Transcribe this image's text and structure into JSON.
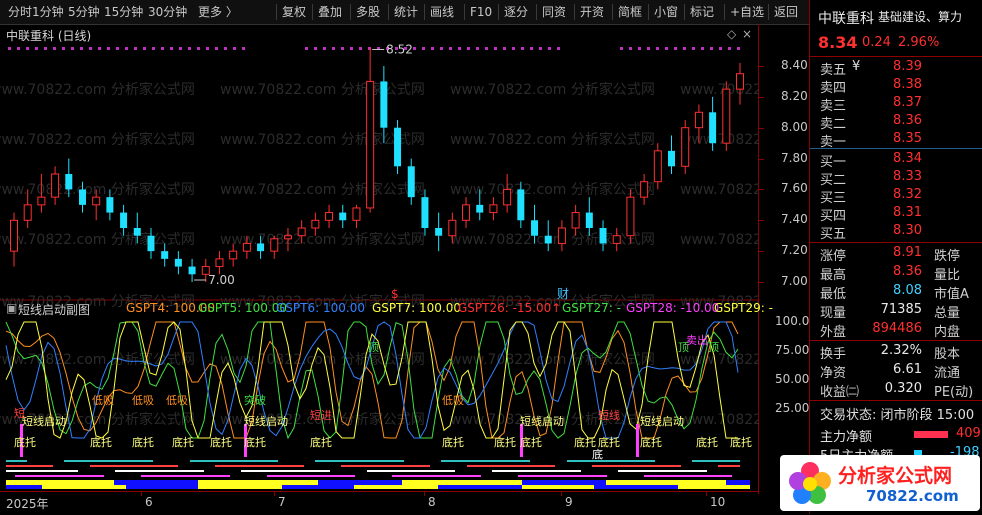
{
  "toolbar": {
    "items": [
      "分时",
      "1分钟",
      "5分钟",
      "15分钟",
      "30分钟",
      "更多 〉",
      "复权",
      "叠加",
      "多股",
      "统计",
      "画线",
      "F10",
      "逐分",
      "同资",
      "开资",
      "简框",
      "小窗",
      "标记",
      "+自选",
      "返回"
    ]
  },
  "chart": {
    "title": "中联重科 (日线)",
    "high_label": "8.52",
    "low_label": "7.00",
    "markers": {
      "s": "$",
      "cai": "财"
    },
    "y_ticks": [
      "8.40",
      "8.20",
      "8.00",
      "7.80",
      "7.60",
      "7.40",
      "7.20",
      "7.00"
    ],
    "sub_ticks": [
      "100.0",
      "75.00",
      "50.00",
      "25.00"
    ],
    "x_labels": [
      "2025年",
      "6",
      "7",
      "8",
      "9",
      "10"
    ],
    "watermark": "www.70822.com 分析家公式网",
    "candles": [
      [
        7.2,
        7.45,
        7.1,
        7.4
      ],
      [
        7.4,
        7.6,
        7.35,
        7.5
      ],
      [
        7.5,
        7.7,
        7.45,
        7.55
      ],
      [
        7.55,
        7.75,
        7.5,
        7.7
      ],
      [
        7.7,
        7.8,
        7.55,
        7.6
      ],
      [
        7.6,
        7.65,
        7.45,
        7.5
      ],
      [
        7.5,
        7.6,
        7.4,
        7.55
      ],
      [
        7.55,
        7.6,
        7.4,
        7.45
      ],
      [
        7.45,
        7.5,
        7.3,
        7.35
      ],
      [
        7.35,
        7.45,
        7.25,
        7.3
      ],
      [
        7.3,
        7.35,
        7.15,
        7.2
      ],
      [
        7.2,
        7.25,
        7.1,
        7.15
      ],
      [
        7.15,
        7.2,
        7.05,
        7.1
      ],
      [
        7.1,
        7.15,
        7.0,
        7.05
      ],
      [
        7.05,
        7.15,
        7.0,
        7.1
      ],
      [
        7.1,
        7.2,
        7.05,
        7.15
      ],
      [
        7.15,
        7.25,
        7.1,
        7.2
      ],
      [
        7.2,
        7.3,
        7.15,
        7.25
      ],
      [
        7.25,
        7.3,
        7.15,
        7.2
      ],
      [
        7.2,
        7.3,
        7.15,
        7.28
      ],
      [
        7.28,
        7.35,
        7.2,
        7.3
      ],
      [
        7.3,
        7.4,
        7.25,
        7.35
      ],
      [
        7.35,
        7.45,
        7.3,
        7.4
      ],
      [
        7.4,
        7.5,
        7.35,
        7.45
      ],
      [
        7.45,
        7.5,
        7.35,
        7.4
      ],
      [
        7.4,
        7.5,
        7.35,
        7.48
      ],
      [
        7.48,
        8.52,
        7.45,
        8.3
      ],
      [
        8.3,
        8.4,
        7.9,
        8.0
      ],
      [
        8.0,
        8.05,
        7.7,
        7.75
      ],
      [
        7.75,
        7.8,
        7.5,
        7.55
      ],
      [
        7.55,
        7.6,
        7.3,
        7.35
      ],
      [
        7.35,
        7.45,
        7.2,
        7.3
      ],
      [
        7.3,
        7.45,
        7.25,
        7.4
      ],
      [
        7.4,
        7.55,
        7.35,
        7.5
      ],
      [
        7.5,
        7.6,
        7.4,
        7.45
      ],
      [
        7.45,
        7.55,
        7.4,
        7.5
      ],
      [
        7.5,
        7.7,
        7.45,
        7.6
      ],
      [
        7.6,
        7.65,
        7.35,
        7.4
      ],
      [
        7.4,
        7.5,
        7.25,
        7.3
      ],
      [
        7.3,
        7.4,
        7.2,
        7.25
      ],
      [
        7.25,
        7.4,
        7.2,
        7.35
      ],
      [
        7.35,
        7.5,
        7.3,
        7.45
      ],
      [
        7.45,
        7.55,
        7.3,
        7.35
      ],
      [
        7.35,
        7.4,
        7.2,
        7.25
      ],
      [
        7.25,
        7.35,
        7.2,
        7.3
      ],
      [
        7.3,
        7.6,
        7.25,
        7.55
      ],
      [
        7.55,
        7.7,
        7.5,
        7.65
      ],
      [
        7.65,
        7.9,
        7.6,
        7.85
      ],
      [
        7.85,
        7.95,
        7.7,
        7.75
      ],
      [
        7.75,
        8.05,
        7.7,
        8.0
      ],
      [
        8.0,
        8.15,
        7.9,
        8.1
      ],
      [
        8.1,
        8.2,
        7.85,
        7.9
      ],
      [
        7.9,
        8.3,
        7.85,
        8.25
      ],
      [
        8.25,
        8.42,
        8.15,
        8.35
      ]
    ]
  },
  "quote": {
    "name": "中联重科",
    "industry": "基础建设、算力",
    "price": "8.34",
    "change": "0.24",
    "pct": "2.96%",
    "asks": [
      [
        "卖五",
        "8.39"
      ],
      [
        "卖四",
        "8.38"
      ],
      [
        "卖三",
        "8.37"
      ],
      [
        "卖二",
        "8.36"
      ],
      [
        "卖一",
        "8.35"
      ]
    ],
    "bids": [
      [
        "买一",
        "8.34"
      ],
      [
        "买二",
        "8.33"
      ],
      [
        "买三",
        "8.32"
      ],
      [
        "买四",
        "8.31"
      ],
      [
        "买五",
        "8.30"
      ]
    ],
    "ask_label_extra": "¥",
    "stats": [
      {
        "l": "涨停",
        "v": "8.91",
        "c": "red",
        "l2": "跌停"
      },
      {
        "l": "最高",
        "v": "8.36",
        "c": "red",
        "l2": "量比"
      },
      {
        "l": "最低",
        "v": "8.08",
        "c": "cyan",
        "l2": "市值A"
      },
      {
        "l": "现量",
        "v": "71385",
        "c": "white",
        "l2": "总量"
      },
      {
        "l": "外盘",
        "v": "894486",
        "c": "red",
        "l2": "内盘"
      }
    ],
    "stats2": [
      {
        "l": "换手",
        "v": "2.32%",
        "l2": "股本"
      },
      {
        "l": "净资",
        "v": "6.61",
        "l2": "流通"
      },
      {
        "l": "收益㈡",
        "v": "0.320",
        "l2": "PE(动)"
      }
    ],
    "trade_state": "交易状态: 闭市阶段 15:00",
    "main_flow_label": "主力净额",
    "main_flow_val": "409",
    "flow5_label": "5日主力净额",
    "flow5_val": "-198",
    "logo_text": "分析家公式网",
    "logo_url": "70822.com"
  },
  "indicator": {
    "legend": [
      {
        "t": "短线启动副图",
        "c": "#d0d0d0"
      },
      {
        "t": "GSPT4: 100.00",
        "c": "#ff9020"
      },
      {
        "t": "GSPT5: 100.00",
        "c": "#40e040"
      },
      {
        "t": "GSPT6: 100.00",
        "c": "#3080ff"
      },
      {
        "t": "GSPT7: 100.00",
        "c": "#ffff40"
      },
      {
        "t": "GSPT26: -15.00↑",
        "c": "#ff3030"
      },
      {
        "t": "GSPT27: -",
        "c": "#40e040"
      },
      {
        "t": "GSPT28: -10.00",
        "c": "#ff40ff"
      },
      {
        "t": "GSPT29: -",
        "c": "#ffff40"
      }
    ],
    "labels": [
      {
        "t": "底托",
        "c": "#ffff80",
        "x": 14,
        "y": 422
      },
      {
        "t": "短线启动",
        "c": "#ffff80",
        "x": 22,
        "y": 401
      },
      {
        "t": "短",
        "c": "#ff4040",
        "x": 14,
        "y": 393
      },
      {
        "t": "低吸",
        "c": "#ff9020",
        "x": 92,
        "y": 380
      },
      {
        "t": "低吸",
        "c": "#ff9020",
        "x": 132,
        "y": 380
      },
      {
        "t": "低吸",
        "c": "#ff9020",
        "x": 166,
        "y": 380
      },
      {
        "t": "底托",
        "c": "#ffff80",
        "x": 90,
        "y": 422
      },
      {
        "t": "底托",
        "c": "#ffff80",
        "x": 132,
        "y": 422
      },
      {
        "t": "底托",
        "c": "#ffff80",
        "x": 172,
        "y": 422
      },
      {
        "t": "底托",
        "c": "#ffff80",
        "x": 210,
        "y": 422
      },
      {
        "t": "突破",
        "c": "#40e040",
        "x": 244,
        "y": 380
      },
      {
        "t": "短线启动",
        "c": "#ffff80",
        "x": 244,
        "y": 401
      },
      {
        "t": "底托",
        "c": "#ffff80",
        "x": 244,
        "y": 422
      },
      {
        "t": "短进",
        "c": "#ff4040",
        "x": 310,
        "y": 395
      },
      {
        "t": "底托",
        "c": "#ffff80",
        "x": 310,
        "y": 422
      },
      {
        "t": "顶",
        "c": "#40e040",
        "x": 368,
        "y": 327
      },
      {
        "t": "低吸",
        "c": "#ff9020",
        "x": 442,
        "y": 380
      },
      {
        "t": "底托",
        "c": "#ffff80",
        "x": 442,
        "y": 422
      },
      {
        "t": "底托",
        "c": "#ffff80",
        "x": 494,
        "y": 422
      },
      {
        "t": "短线启动",
        "c": "#ffff80",
        "x": 520,
        "y": 401
      },
      {
        "t": "底托",
        "c": "#ffff80",
        "x": 520,
        "y": 422
      },
      {
        "t": "底托",
        "c": "#ffff80",
        "x": 574,
        "y": 422
      },
      {
        "t": "底",
        "c": "#ffffff",
        "x": 592,
        "y": 434
      },
      {
        "t": "短线",
        "c": "#ff4040",
        "x": 598,
        "y": 395
      },
      {
        "t": "底托",
        "c": "#ffff80",
        "x": 598,
        "y": 422
      },
      {
        "t": "短线启动",
        "c": "#ffff80",
        "x": 640,
        "y": 401
      },
      {
        "t": "底托",
        "c": "#ffff80",
        "x": 640,
        "y": 422
      },
      {
        "t": "底托",
        "c": "#ffff80",
        "x": 696,
        "y": 422
      },
      {
        "t": "底托",
        "c": "#ffff80",
        "x": 730,
        "y": 422
      },
      {
        "t": "顶",
        "c": "#40e040",
        "x": 678,
        "y": 327
      },
      {
        "t": "顶",
        "c": "#40e040",
        "x": 708,
        "y": 327
      },
      {
        "t": "卖出",
        "c": "#ff40ff",
        "x": 686,
        "y": 320
      }
    ]
  }
}
